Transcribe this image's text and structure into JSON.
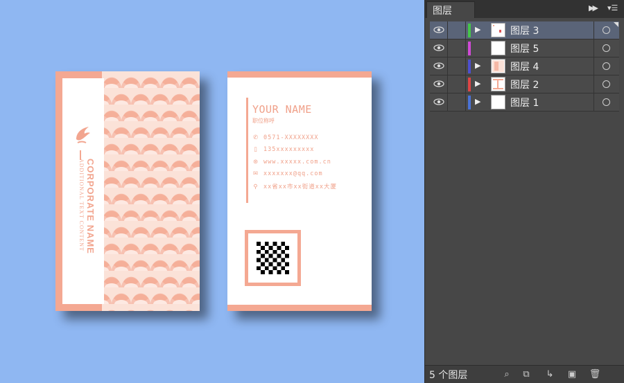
{
  "card_front": {
    "company_name": "CORPORATE NAME",
    "company_sub": "ADDITIONAL TEXT CONTENT",
    "accent_color": "#f4a892"
  },
  "card_back": {
    "name": "YOUR NAME",
    "title": "职位称呼",
    "contacts": [
      {
        "icon": "phone-icon",
        "glyph": "✆",
        "text": "0571-XXXXXXXX"
      },
      {
        "icon": "mobile-icon",
        "glyph": "▯",
        "text": "135xxxxxxxxx"
      },
      {
        "icon": "globe-icon",
        "glyph": "⊛",
        "text": "www.xxxxx.com.cn"
      },
      {
        "icon": "email-icon",
        "glyph": "✉",
        "text": "xxxxxxx@qq.com"
      },
      {
        "icon": "location-icon",
        "glyph": "⚲",
        "text": "xx省xx市xx街道xx大厦"
      }
    ]
  },
  "layers_panel": {
    "tab_title": "图层",
    "layers": [
      {
        "name": "图层 3",
        "color": "#46c54a",
        "selected": true
      },
      {
        "name": "图层 5",
        "color": "#d04ad6",
        "selected": false
      },
      {
        "name": "图层 4",
        "color": "#4d4fd0",
        "selected": false
      },
      {
        "name": "图层 2",
        "color": "#dd4545",
        "selected": false
      },
      {
        "name": "图层 1",
        "color": "#4a72d6",
        "selected": false
      }
    ],
    "footer_count": "5 个图层"
  }
}
